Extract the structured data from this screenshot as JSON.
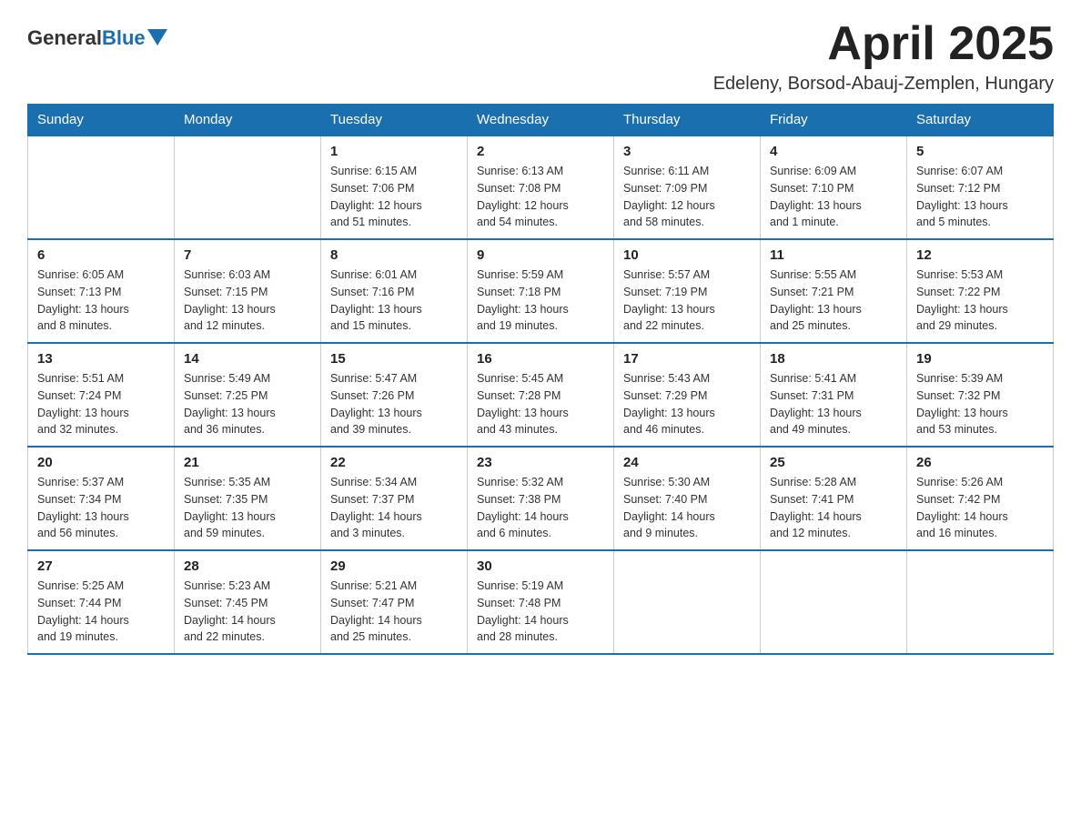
{
  "logo": {
    "text1": "General",
    "text2": "Blue"
  },
  "title": {
    "month": "April 2025",
    "location": "Edeleny, Borsod-Abauj-Zemplen, Hungary"
  },
  "days_of_week": [
    "Sunday",
    "Monday",
    "Tuesday",
    "Wednesday",
    "Thursday",
    "Friday",
    "Saturday"
  ],
  "weeks": [
    [
      {
        "day": "",
        "info": ""
      },
      {
        "day": "",
        "info": ""
      },
      {
        "day": "1",
        "info": "Sunrise: 6:15 AM\nSunset: 7:06 PM\nDaylight: 12 hours\nand 51 minutes."
      },
      {
        "day": "2",
        "info": "Sunrise: 6:13 AM\nSunset: 7:08 PM\nDaylight: 12 hours\nand 54 minutes."
      },
      {
        "day": "3",
        "info": "Sunrise: 6:11 AM\nSunset: 7:09 PM\nDaylight: 12 hours\nand 58 minutes."
      },
      {
        "day": "4",
        "info": "Sunrise: 6:09 AM\nSunset: 7:10 PM\nDaylight: 13 hours\nand 1 minute."
      },
      {
        "day": "5",
        "info": "Sunrise: 6:07 AM\nSunset: 7:12 PM\nDaylight: 13 hours\nand 5 minutes."
      }
    ],
    [
      {
        "day": "6",
        "info": "Sunrise: 6:05 AM\nSunset: 7:13 PM\nDaylight: 13 hours\nand 8 minutes."
      },
      {
        "day": "7",
        "info": "Sunrise: 6:03 AM\nSunset: 7:15 PM\nDaylight: 13 hours\nand 12 minutes."
      },
      {
        "day": "8",
        "info": "Sunrise: 6:01 AM\nSunset: 7:16 PM\nDaylight: 13 hours\nand 15 minutes."
      },
      {
        "day": "9",
        "info": "Sunrise: 5:59 AM\nSunset: 7:18 PM\nDaylight: 13 hours\nand 19 minutes."
      },
      {
        "day": "10",
        "info": "Sunrise: 5:57 AM\nSunset: 7:19 PM\nDaylight: 13 hours\nand 22 minutes."
      },
      {
        "day": "11",
        "info": "Sunrise: 5:55 AM\nSunset: 7:21 PM\nDaylight: 13 hours\nand 25 minutes."
      },
      {
        "day": "12",
        "info": "Sunrise: 5:53 AM\nSunset: 7:22 PM\nDaylight: 13 hours\nand 29 minutes."
      }
    ],
    [
      {
        "day": "13",
        "info": "Sunrise: 5:51 AM\nSunset: 7:24 PM\nDaylight: 13 hours\nand 32 minutes."
      },
      {
        "day": "14",
        "info": "Sunrise: 5:49 AM\nSunset: 7:25 PM\nDaylight: 13 hours\nand 36 minutes."
      },
      {
        "day": "15",
        "info": "Sunrise: 5:47 AM\nSunset: 7:26 PM\nDaylight: 13 hours\nand 39 minutes."
      },
      {
        "day": "16",
        "info": "Sunrise: 5:45 AM\nSunset: 7:28 PM\nDaylight: 13 hours\nand 43 minutes."
      },
      {
        "day": "17",
        "info": "Sunrise: 5:43 AM\nSunset: 7:29 PM\nDaylight: 13 hours\nand 46 minutes."
      },
      {
        "day": "18",
        "info": "Sunrise: 5:41 AM\nSunset: 7:31 PM\nDaylight: 13 hours\nand 49 minutes."
      },
      {
        "day": "19",
        "info": "Sunrise: 5:39 AM\nSunset: 7:32 PM\nDaylight: 13 hours\nand 53 minutes."
      }
    ],
    [
      {
        "day": "20",
        "info": "Sunrise: 5:37 AM\nSunset: 7:34 PM\nDaylight: 13 hours\nand 56 minutes."
      },
      {
        "day": "21",
        "info": "Sunrise: 5:35 AM\nSunset: 7:35 PM\nDaylight: 13 hours\nand 59 minutes."
      },
      {
        "day": "22",
        "info": "Sunrise: 5:34 AM\nSunset: 7:37 PM\nDaylight: 14 hours\nand 3 minutes."
      },
      {
        "day": "23",
        "info": "Sunrise: 5:32 AM\nSunset: 7:38 PM\nDaylight: 14 hours\nand 6 minutes."
      },
      {
        "day": "24",
        "info": "Sunrise: 5:30 AM\nSunset: 7:40 PM\nDaylight: 14 hours\nand 9 minutes."
      },
      {
        "day": "25",
        "info": "Sunrise: 5:28 AM\nSunset: 7:41 PM\nDaylight: 14 hours\nand 12 minutes."
      },
      {
        "day": "26",
        "info": "Sunrise: 5:26 AM\nSunset: 7:42 PM\nDaylight: 14 hours\nand 16 minutes."
      }
    ],
    [
      {
        "day": "27",
        "info": "Sunrise: 5:25 AM\nSunset: 7:44 PM\nDaylight: 14 hours\nand 19 minutes."
      },
      {
        "day": "28",
        "info": "Sunrise: 5:23 AM\nSunset: 7:45 PM\nDaylight: 14 hours\nand 22 minutes."
      },
      {
        "day": "29",
        "info": "Sunrise: 5:21 AM\nSunset: 7:47 PM\nDaylight: 14 hours\nand 25 minutes."
      },
      {
        "day": "30",
        "info": "Sunrise: 5:19 AM\nSunset: 7:48 PM\nDaylight: 14 hours\nand 28 minutes."
      },
      {
        "day": "",
        "info": ""
      },
      {
        "day": "",
        "info": ""
      },
      {
        "day": "",
        "info": ""
      }
    ]
  ]
}
